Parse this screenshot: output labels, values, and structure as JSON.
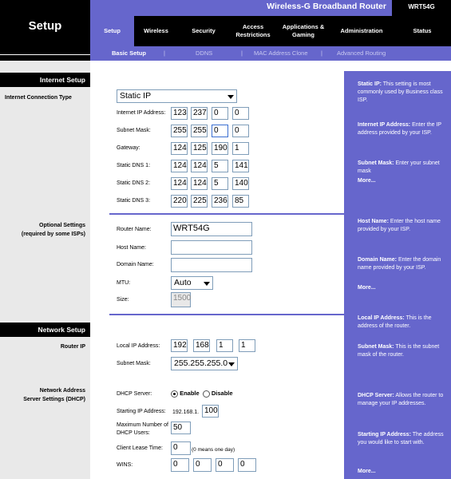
{
  "header": {
    "page_title": "Setup",
    "product_name": "Wireless-G Broadband Router",
    "model": "WRT54G"
  },
  "tabs": [
    {
      "label": "Setup",
      "active": true
    },
    {
      "label": "Wireless",
      "active": false
    },
    {
      "label": "Security",
      "active": false
    },
    {
      "label": "Access Restrictions",
      "active": false
    },
    {
      "label": "Applications & Gaming",
      "active": false
    },
    {
      "label": "Administration",
      "active": false
    },
    {
      "label": "Status",
      "active": false
    }
  ],
  "subnav": {
    "items": [
      "Basic Setup",
      "DDNS",
      "MAC Address Clone",
      "Advanced Routing"
    ],
    "separator": "|"
  },
  "left": {
    "internet_setup": "Internet Setup",
    "internet_connection_type": "Internet Connection Type",
    "optional_settings": "Optional Settings",
    "optional_settings_note": "(required by some ISPs)",
    "network_setup": "Network Setup",
    "router_ip": "Router IP",
    "nat_server": "Network Address",
    "nat_server2": "Server Settings (DHCP)"
  },
  "form": {
    "connection_type": "Static IP",
    "internet_ip_label": "Internet IP Address:",
    "internet_ip": [
      "123",
      "237",
      "0",
      "0"
    ],
    "subnet_label": "Subnet Mask:",
    "subnet": [
      "255",
      "255",
      "0",
      "0"
    ],
    "gateway_label": "Gateway:",
    "gateway": [
      "124",
      "125",
      "190",
      "1"
    ],
    "dns1_label": "Static DNS 1:",
    "dns1": [
      "124",
      "124",
      "5",
      "141"
    ],
    "dns2_label": "Static DNS 2:",
    "dns2": [
      "124",
      "124",
      "5",
      "140"
    ],
    "dns3_label": "Static DNS 3:",
    "dns3": [
      "220",
      "225",
      "236",
      "85"
    ],
    "router_name_label": "Router Name:",
    "router_name": "WRT54G",
    "host_name_label": "Host Name:",
    "host_name": "",
    "domain_name_label": "Domain Name:",
    "domain_name": "",
    "mtu_label": "MTU:",
    "mtu": "Auto",
    "size_label": "Size:",
    "size": "1500",
    "local_ip_label": "Local IP Address:",
    "local_ip": [
      "192",
      "168",
      "1",
      "1"
    ],
    "lan_subnet_label": "Subnet Mask:",
    "lan_subnet": "255.255.255.0",
    "dhcp_server_label": "DHCP Server:",
    "dhcp_enable": "Enable",
    "dhcp_disable": "Disable",
    "start_ip_label": "Starting IP Address:",
    "start_ip_prefix": "192.168.1.",
    "start_ip": "100",
    "max_users_label": "Maximum Number of",
    "max_users_label2": "DHCP Users:",
    "max_users": "50",
    "lease_label": "Client Lease Time:",
    "lease": "0",
    "lease_note": "(0 means one day)",
    "wins_label": "WINS:",
    "wins": [
      "0",
      "0",
      "0",
      "0"
    ]
  },
  "help": {
    "static_ip_title": "Static IP:",
    "static_ip_text": "This setting is most commonly used by Business class ISP.",
    "internet_ip_title": "Internet IP Address:",
    "internet_ip_text": "Enter the IP address provided by your ISP.",
    "subnet_title": "Subnet Mask:",
    "subnet_text": "Enter your subnet mask",
    "more1": "More...",
    "host_title": "Host Name:",
    "host_text": "Enter the host name provided by your ISP.",
    "domain_title": "Domain Name:",
    "domain_text": "Enter the domain name provided by your ISP.",
    "more2": "More...",
    "local_ip_title": "Local IP Address:",
    "local_ip_text": "This is the address of the router.",
    "lan_subnet_title": "Subnet Mask:",
    "lan_subnet_text": "This is the subnet mask of the router.",
    "dhcp_title": "DHCP Server:",
    "dhcp_text": "Allows the router to manage your IP addresses.",
    "start_title": "Starting IP Address:",
    "start_text": "The address you would like to start with.",
    "more3": "More..."
  },
  "colors": {
    "accent": "#6666cc",
    "header_bg": "#000000",
    "left_bg": "#e9e9e9"
  }
}
